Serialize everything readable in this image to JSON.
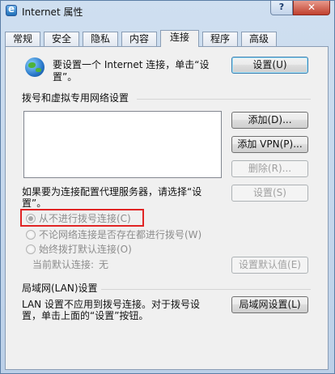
{
  "window": {
    "title": "Internet 属性",
    "help_label": "?",
    "close_label": "✕"
  },
  "tabs": [
    {
      "label": "常规",
      "active": false
    },
    {
      "label": "安全",
      "active": false
    },
    {
      "label": "隐私",
      "active": false
    },
    {
      "label": "内容",
      "active": false
    },
    {
      "label": "连接",
      "active": true
    },
    {
      "label": "程序",
      "active": false
    },
    {
      "label": "高级",
      "active": false
    }
  ],
  "setup": {
    "icon": "globe-network-icon",
    "text_line1": "要设置一个 Internet 连接，单击“设",
    "text_line2": "置”。",
    "button_label": "设置(U)"
  },
  "dialup": {
    "section_title": "拨号和虚拟专用网络设置",
    "add_button": "添加(D)...",
    "add_vpn_button": "添加 VPN(P)...",
    "remove_button": "删除(R)...",
    "proxy_text_line1": "如果要为连接配置代理服务器，请选择“设",
    "proxy_text_line2": "置”。",
    "settings_button": "设置(S)",
    "radio_options": [
      {
        "label": "从不进行拨号连接(C)",
        "checked": true
      },
      {
        "label": "不论网络连接是否存在都进行拨号(W)",
        "checked": false
      },
      {
        "label": "始终拨打默认连接(O)",
        "checked": false
      }
    ],
    "current_default_label": "当前默认连接:",
    "current_default_value": "无",
    "set_default_button": "设置默认值(E)"
  },
  "lan": {
    "section_title": "局域网(LAN)设置",
    "text_line1": "LAN 设置不应用到拨号连接。对于拨号设",
    "text_line2": "置，单击上面的“设置”按钮。",
    "button_label": "局域网设置(L)"
  }
}
